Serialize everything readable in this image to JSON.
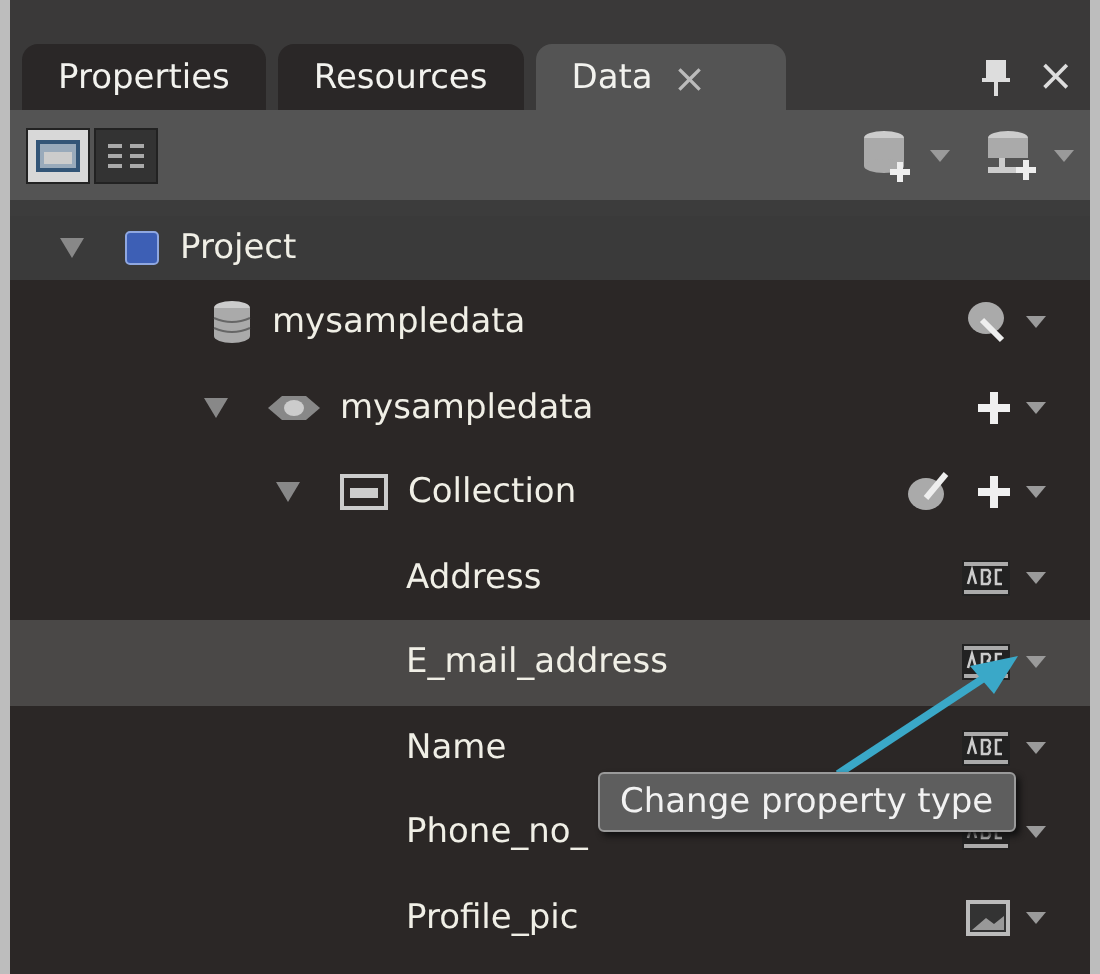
{
  "tabs": [
    {
      "label": "Properties",
      "selected": false
    },
    {
      "label": "Resources",
      "selected": false
    },
    {
      "label": "Data",
      "selected": true,
      "close": "×"
    }
  ],
  "panel_controls": {
    "close": "×"
  },
  "toolbar": {
    "views": [
      {
        "kind": "list",
        "selected": true
      },
      {
        "kind": "columns",
        "selected": false
      }
    ]
  },
  "tree": [
    {
      "label": "Project",
      "kind": "project",
      "expanded": true,
      "children": [
        {
          "label": "mysampledata",
          "kind": "datasource",
          "children": [
            {
              "label": "mysampledata",
              "kind": "schema",
              "expanded": true,
              "children": [
                {
                  "label": "Collection",
                  "kind": "collection",
                  "expanded": true,
                  "children": [
                    {
                      "label": "Address",
                      "kind": "string",
                      "selected": false
                    },
                    {
                      "label": "E_mail_address",
                      "kind": "string",
                      "selected": true
                    },
                    {
                      "label": "Name",
                      "kind": "string",
                      "selected": false
                    },
                    {
                      "label": "Phone_no_",
                      "kind": "string",
                      "selected": false
                    },
                    {
                      "label": "Profile_pic",
                      "kind": "image",
                      "selected": false
                    }
                  ]
                }
              ]
            }
          ]
        }
      ]
    }
  ],
  "tooltip": {
    "text": "Change property type"
  }
}
